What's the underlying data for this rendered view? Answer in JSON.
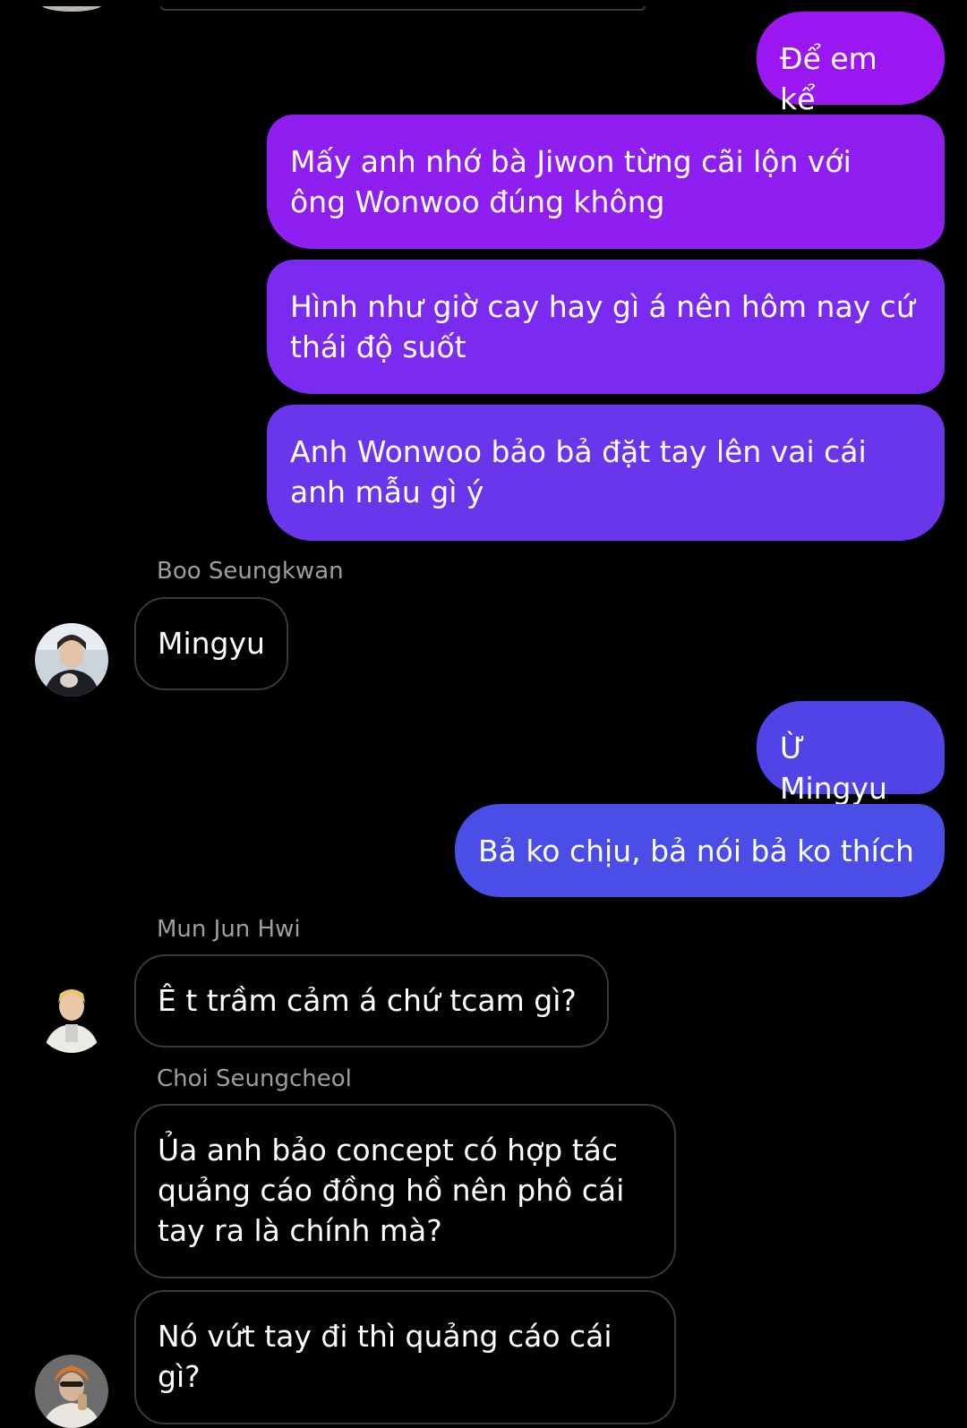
{
  "messages": {
    "m1": "Để em kể",
    "m2_l1": "Mấy anh nhớ bà Jiwon từng cãi lộn với",
    "m2_l2": "ông Wonwoo đúng không",
    "m3_l1": "Hình như giờ cay hay gì á nên hôm nay cứ",
    "m3_l2": "thái độ suốt",
    "m4_l1": "Anh Wonwoo bảo bả đặt tay lên vai cái",
    "m4_l2": "anh mẫu gì ý",
    "m5": "Mingyu",
    "m6": "Ừ Mingyu",
    "m7": "Bả ko chịu, bả nói bả ko thích",
    "m8": "Ê t trầm cảm á chứ tcam gì?",
    "m9_l1": "Ủa anh bảo concept có hợp tác",
    "m9_l2": "quảng cáo đồng hồ nên phô cái",
    "m9_l3": "tay ra là chính mà?",
    "m10_l1": "Nó vứt tay đi thì quảng cáo cái",
    "m10_l2": "gì?"
  },
  "senders": {
    "boo": "Boo Seungkwan",
    "jun": "Mun Jun Hwi",
    "choi": "Choi Seungcheol"
  },
  "colors": {
    "outgoing_top": "#9b17f2",
    "outgoing_mid": "#7a2cf0",
    "outgoing_bottom": "#4a4de6",
    "incoming_border": "#3a3a3a",
    "name_text": "#9e9e9e",
    "background": "#000000"
  },
  "icons": {
    "avatar_boo": "user-avatar-photo",
    "avatar_jun": "user-avatar-photo",
    "avatar_choi": "user-avatar-photo"
  }
}
